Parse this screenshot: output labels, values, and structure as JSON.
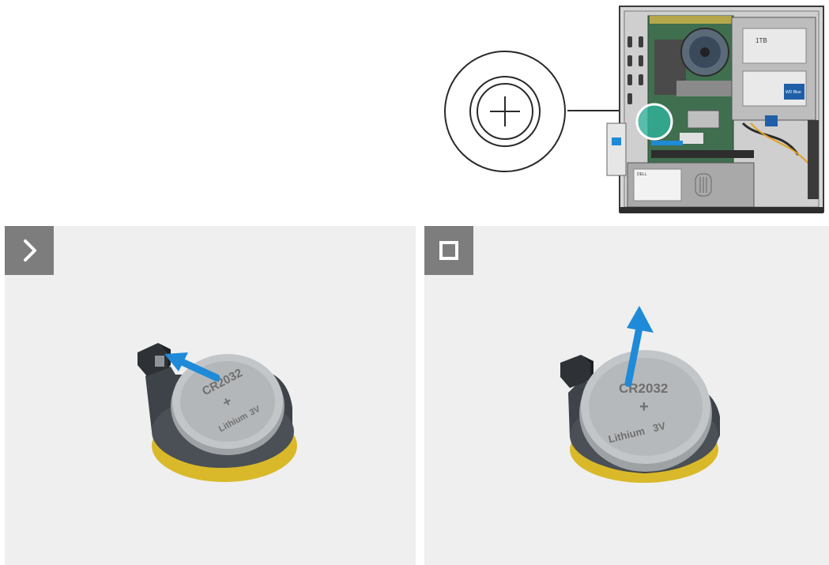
{
  "overview": {
    "callout_icon": "phillips-screw-icon",
    "chassis_labels": {
      "drive_capacity": "1TB",
      "drive_brand": "WD Blue",
      "psu_brand": "DELL"
    }
  },
  "steps": [
    {
      "icon": "chevron-right-icon",
      "illustration": "coin-cell-battery-release-latch",
      "battery": {
        "model": "CR2032",
        "type": "Lithium",
        "voltage": "3V",
        "polarity": "+"
      }
    },
    {
      "icon": "stop-square-icon",
      "illustration": "coin-cell-battery-lift-out",
      "battery": {
        "model": "CR2032",
        "type": "Lithium",
        "voltage": "3V",
        "polarity": "+"
      }
    }
  ],
  "colors": {
    "arrow": "#1f8ad8",
    "badge": "#7d7d7d",
    "panel": "#efefef",
    "battery_metal": "#b9b9b9",
    "battery_base": "#d9b92a"
  }
}
